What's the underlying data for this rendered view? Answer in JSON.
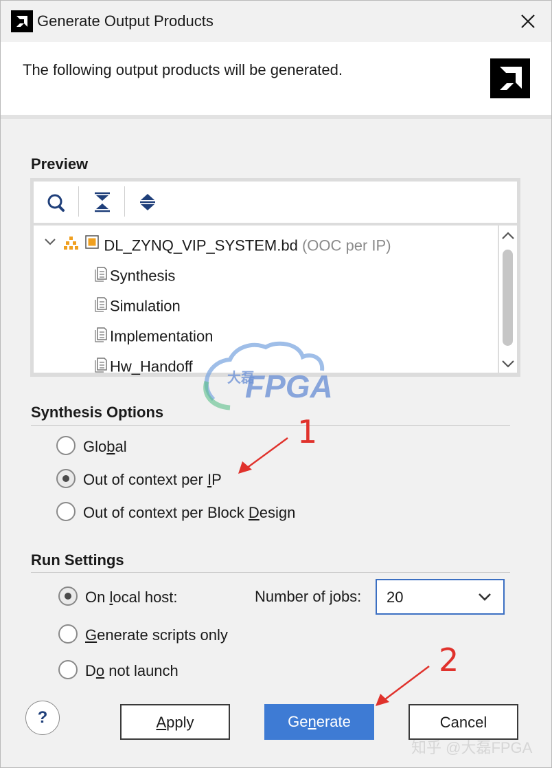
{
  "window": {
    "title": "Generate Output Products"
  },
  "banner": {
    "text": "The following output products will be generated."
  },
  "preview": {
    "heading": "Preview",
    "toolbar": [
      "search-icon",
      "collapse-all-icon",
      "expand-all-icon"
    ],
    "root": {
      "name": "DL_ZYNQ_VIP_SYSTEM.bd",
      "mode": "(OOC per IP)"
    },
    "children": [
      "Synthesis",
      "Simulation",
      "Implementation",
      "Hw_Handoff"
    ]
  },
  "synthesis_options": {
    "heading": "Synthesis Options",
    "options": [
      {
        "label": "Global",
        "checked": false
      },
      {
        "label": "Out of context per IP",
        "checked": true
      },
      {
        "label": "Out of context per Block Design",
        "checked": false
      }
    ]
  },
  "run_settings": {
    "heading": "Run Settings",
    "options": [
      {
        "label": "On local host:",
        "checked": true
      },
      {
        "label": "Generate scripts only",
        "checked": false
      },
      {
        "label": "Do not launch",
        "checked": false
      }
    ],
    "jobs_label": "Number of jobs:",
    "jobs_value": "20"
  },
  "buttons": {
    "help": "?",
    "apply": "Apply",
    "generate": "Generate",
    "cancel": "Cancel"
  },
  "annotations": {
    "marker1": "1",
    "marker2": "2"
  },
  "watermark": {
    "text": "FPGA",
    "cn": "大磊",
    "corner": "知乎 @大磊FPGA"
  },
  "colors": {
    "accent": "#3e7bd4",
    "annotation": "#e0322c",
    "ip_orange": "#f0a020"
  }
}
